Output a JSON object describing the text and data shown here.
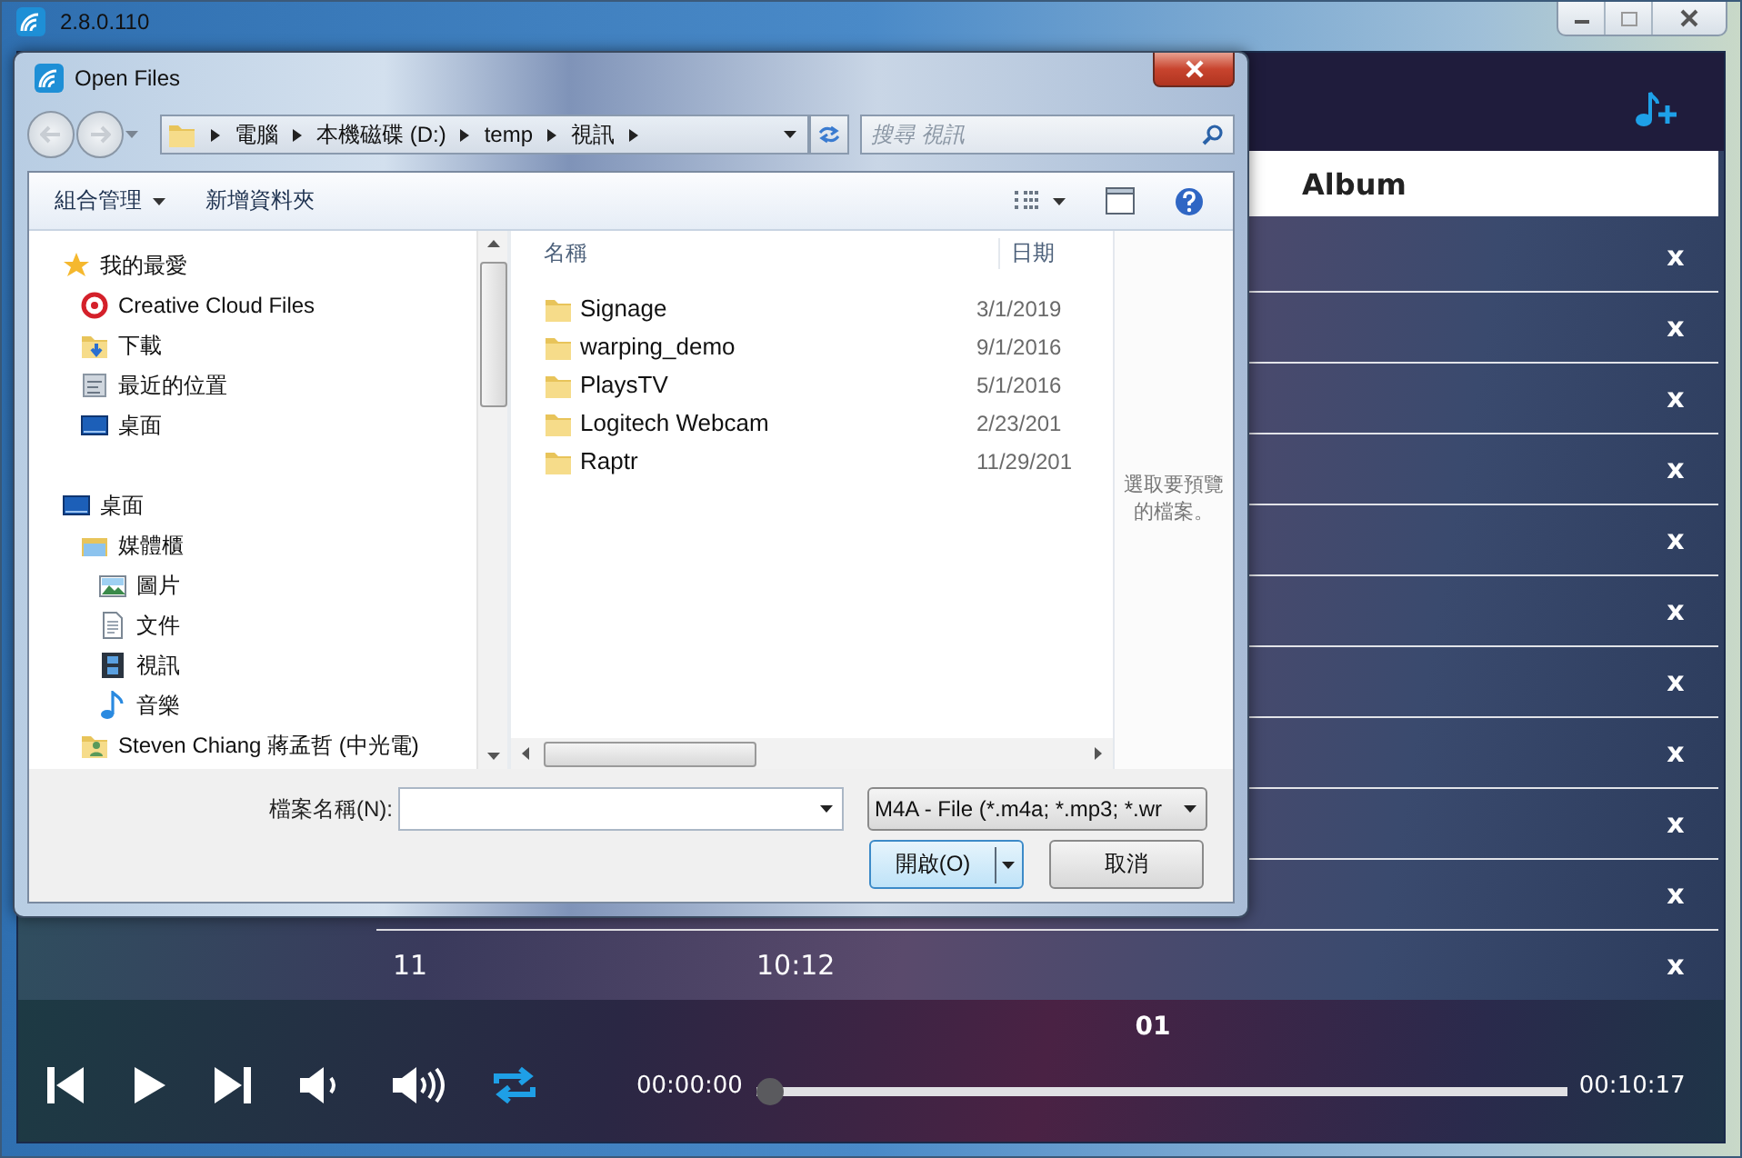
{
  "app": {
    "version": "2.8.0.110",
    "playlist": {
      "column_header": "Album",
      "rows": [
        {
          "remove": "x"
        },
        {
          "remove": "x"
        },
        {
          "remove": "x"
        },
        {
          "remove": "x"
        },
        {
          "remove": "x"
        },
        {
          "remove": "x"
        },
        {
          "remove": "x"
        },
        {
          "remove": "x"
        },
        {
          "remove": "x"
        },
        {
          "remove": "x"
        },
        {
          "number": "11",
          "duration": "10:12",
          "remove": "x"
        }
      ]
    },
    "player": {
      "track_title": "01",
      "elapsed": "00:00:00",
      "total": "00:10:17",
      "progress": {
        "level": 0
      },
      "repeat": {
        "on": true
      }
    }
  },
  "dialog": {
    "title": "Open Files",
    "breadcrumb": [
      "電腦",
      "本機磁碟 (D:)",
      "temp",
      "視訊"
    ],
    "search": {
      "placeholder": "搜尋 視訊"
    },
    "toolbar": [
      "組合管理",
      "新增資料夾"
    ],
    "nav": [
      {
        "label": "我的最愛",
        "kind": "favorites",
        "children": [
          {
            "label": "Creative Cloud Files",
            "kind": "cloud"
          },
          {
            "label": "下載",
            "kind": "downloads"
          },
          {
            "label": "最近的位置",
            "kind": "recent"
          },
          {
            "label": "桌面",
            "kind": "desktop"
          }
        ]
      },
      {
        "label": "桌面",
        "kind": "desktop",
        "children": [
          {
            "label": "媒體櫃",
            "kind": "library",
            "children": [
              {
                "label": "圖片",
                "kind": "pictures"
              },
              {
                "label": "文件",
                "kind": "documents"
              },
              {
                "label": "視訊",
                "kind": "videos"
              },
              {
                "label": "音樂",
                "kind": "music"
              }
            ]
          },
          {
            "label": "Steven Chiang 蔣孟哲 (中光電)",
            "kind": "user"
          }
        ]
      }
    ],
    "columns": [
      "名稱",
      "日期"
    ],
    "files": [
      {
        "name": "Signage",
        "date": "3/1/2019"
      },
      {
        "name": "warping_demo",
        "date": "9/1/2016"
      },
      {
        "name": "PlaysTV",
        "date": "5/1/2016"
      },
      {
        "name": "Logitech Webcam",
        "date": "2/23/201"
      },
      {
        "name": "Raptr",
        "date": "11/29/201"
      }
    ],
    "preview_hint": "選取要預覽的檔案。",
    "filename_label": "檔案名稱(N):",
    "filetype": "M4A - File (*.m4a; *.mp3; *.wr",
    "buttons": {
      "open": "開啟(O)",
      "cancel": "取消"
    }
  }
}
